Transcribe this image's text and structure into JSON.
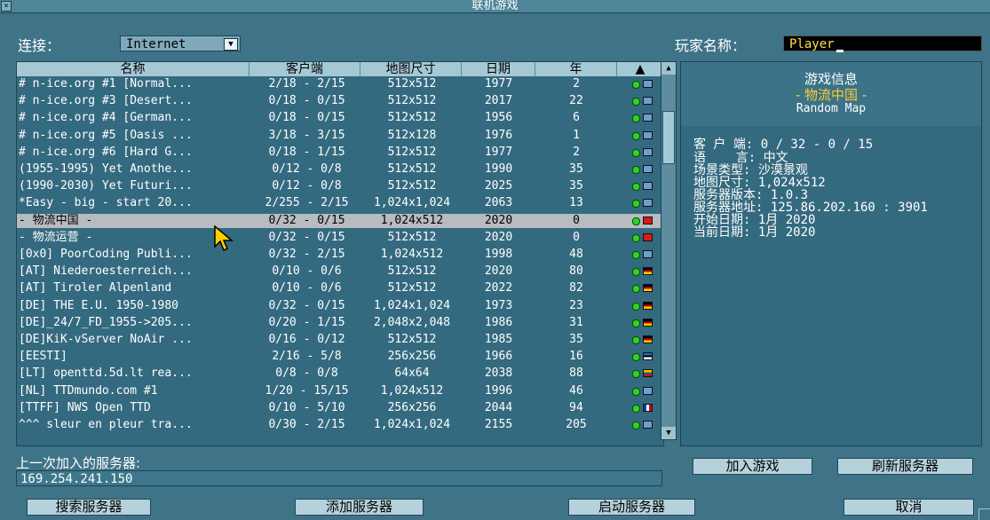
{
  "window": {
    "title": "联机游戏"
  },
  "connection": {
    "label": "连接：",
    "value": "Internet"
  },
  "player": {
    "label": "玩家名称：",
    "value": "Player"
  },
  "list": {
    "columns": [
      "名称",
      "客户端",
      "地图尺寸",
      "日期",
      "年"
    ],
    "rows": [
      {
        "name": "# n-ice.org #1 [Normal...",
        "clients": "2/18 - 2/15",
        "map": "512x512",
        "date": "1977",
        "years": "2",
        "flag": "i"
      },
      {
        "name": "# n-ice.org #3 [Desert...",
        "clients": "0/18 - 0/15",
        "map": "512x512",
        "date": "2017",
        "years": "22",
        "flag": "i"
      },
      {
        "name": "# n-ice.org #4 [German...",
        "clients": "0/18 - 0/15",
        "map": "512x512",
        "date": "1956",
        "years": "6",
        "flag": "i"
      },
      {
        "name": "# n-ice.org #5 [Oasis ...",
        "clients": "3/18 - 3/15",
        "map": "512x128",
        "date": "1976",
        "years": "1",
        "flag": "i"
      },
      {
        "name": "# n-ice.org #6 [Hard G...",
        "clients": "0/18 - 1/15",
        "map": "512x512",
        "date": "1977",
        "years": "2",
        "flag": "i"
      },
      {
        "name": "(1955-1995) Yet Anothe...",
        "clients": "0/12 - 0/8",
        "map": "512x512",
        "date": "1990",
        "years": "35",
        "flag": "i"
      },
      {
        "name": "(1990-2030) Yet Futuri...",
        "clients": "0/12 - 0/8",
        "map": "512x512",
        "date": "2025",
        "years": "35",
        "flag": "i"
      },
      {
        "name": "*Easy - big - start 20...",
        "clients": "2/255 - 2/15",
        "map": "1,024x1,024",
        "date": "2063",
        "years": "13",
        "flag": "i"
      },
      {
        "name": "- 物流中国 -",
        "clients": "0/32 - 0/15",
        "map": "1,024x512",
        "date": "2020",
        "years": "0",
        "flag": "cn",
        "selected": true
      },
      {
        "name": "- 物流运营 -",
        "clients": "0/32 - 0/15",
        "map": "512x512",
        "date": "2020",
        "years": "0",
        "flag": "cn"
      },
      {
        "name": "[0x0] PoorCoding Publi...",
        "clients": "0/32 - 2/15",
        "map": "1,024x512",
        "date": "1998",
        "years": "48",
        "flag": "i"
      },
      {
        "name": "[AT] Niederoesterreich...",
        "clients": "0/10 - 0/6",
        "map": "512x512",
        "date": "2020",
        "years": "80",
        "flag": "de"
      },
      {
        "name": "[AT] Tiroler Alpenland",
        "clients": "0/10 - 0/6",
        "map": "512x512",
        "date": "2022",
        "years": "82",
        "flag": "de"
      },
      {
        "name": "[DE] THE E.U. 1950-1980",
        "clients": "0/32 - 0/15",
        "map": "1,024x1,024",
        "date": "1973",
        "years": "23",
        "flag": "de"
      },
      {
        "name": "[DE]_24/7_FD_1955->205...",
        "clients": "0/20 - 1/15",
        "map": "2,048x2,048",
        "date": "1986",
        "years": "31",
        "flag": "de"
      },
      {
        "name": "[DE]KiK-vServer NoAir ...",
        "clients": "0/16 - 0/12",
        "map": "512x512",
        "date": "1985",
        "years": "35",
        "flag": "de"
      },
      {
        "name": "[EESTI]",
        "clients": "2/16 - 5/8",
        "map": "256x256",
        "date": "1966",
        "years": "16",
        "flag": "ee"
      },
      {
        "name": "[LT] openttd.5d.lt rea...",
        "clients": "0/8 - 0/8",
        "map": "64x64",
        "date": "2038",
        "years": "88",
        "flag": "lt"
      },
      {
        "name": "[NL] TTDmundo.com #1",
        "clients": "1/20 - 15/15",
        "map": "1,024x512",
        "date": "1996",
        "years": "46",
        "flag": "i"
      },
      {
        "name": "[TTFF] NWS Open TTD",
        "clients": "0/10 - 5/10",
        "map": "256x256",
        "date": "2044",
        "years": "94",
        "flag": "fr"
      },
      {
        "name": "^^^ sleur en pleur tra...",
        "clients": "0/30 - 2/15",
        "map": "1,024x1,024",
        "date": "2155",
        "years": "205",
        "flag": "i"
      }
    ]
  },
  "info": {
    "heading": "游戏信息",
    "game_name": "- 物流中国 -",
    "map_name": "Random Map",
    "lines": [
      "客 户 端: 0 / 32 - 0 / 15",
      "语    言: 中文",
      "场景类型: 沙漠景观",
      "地图尺寸: 1,024x512",
      "服务器版本: 1.0.3",
      "服务器地址: 125.86.202.160 : 3901",
      "开始日期: 1月 2020",
      "当前日期: 1月 2020"
    ]
  },
  "last_server": {
    "label": "上一次加入的服务器:",
    "value": "169.254.241.150"
  },
  "buttons": {
    "join": "加入游戏",
    "refresh": "刷新服务器",
    "search": "搜索服务器",
    "add": "添加服务器",
    "start": "启动服务器",
    "cancel": "取消"
  },
  "icons": {
    "close": "close-box-icon",
    "dropdown": "chevron-down-icon",
    "pointer": "mouse-pointer-icon"
  }
}
